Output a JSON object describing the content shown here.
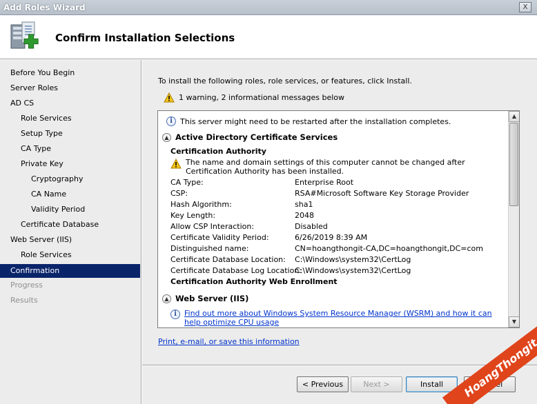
{
  "window": {
    "title": "Add Roles Wizard",
    "close_glyph": "X"
  },
  "header": {
    "page_title": "Confirm Installation Selections",
    "icon": "server-add-icon"
  },
  "sidebar": {
    "items": [
      {
        "label": "Before You Begin",
        "level": 1,
        "state": "normal"
      },
      {
        "label": "Server Roles",
        "level": 1,
        "state": "normal"
      },
      {
        "label": "AD CS",
        "level": 1,
        "state": "normal"
      },
      {
        "label": "Role Services",
        "level": 2,
        "state": "normal"
      },
      {
        "label": "Setup Type",
        "level": 2,
        "state": "normal"
      },
      {
        "label": "CA Type",
        "level": 2,
        "state": "normal"
      },
      {
        "label": "Private Key",
        "level": 2,
        "state": "normal"
      },
      {
        "label": "Cryptography",
        "level": 3,
        "state": "normal"
      },
      {
        "label": "CA Name",
        "level": 3,
        "state": "normal"
      },
      {
        "label": "Validity Period",
        "level": 3,
        "state": "normal"
      },
      {
        "label": "Certificate Database",
        "level": 2,
        "state": "normal"
      },
      {
        "label": "Web Server (IIS)",
        "level": 1,
        "state": "normal"
      },
      {
        "label": "Role Services",
        "level": 2,
        "state": "normal"
      },
      {
        "label": "Confirmation",
        "level": 1,
        "state": "active"
      },
      {
        "label": "Progress",
        "level": 1,
        "state": "disabled"
      },
      {
        "label": "Results",
        "level": 1,
        "state": "disabled"
      }
    ]
  },
  "main": {
    "intro": "To install the following roles, role services, or features, click Install.",
    "summary_warning": "1 warning, 2 informational messages below",
    "restart_note": "This server might need to be restarted after the installation completes.",
    "adcs_section": "Active Directory Certificate Services",
    "ca_heading": "Certification Authority",
    "ca_warning": "The name and domain settings of this computer cannot be changed after Certification Authority has been installed.",
    "details": [
      {
        "label": "CA Type:",
        "value": "Enterprise Root"
      },
      {
        "label": "CSP:",
        "value": "RSA#Microsoft Software Key Storage Provider"
      },
      {
        "label": "Hash Algorithm:",
        "value": "sha1"
      },
      {
        "label": "Key Length:",
        "value": "2048"
      },
      {
        "label": "Allow CSP Interaction:",
        "value": "Disabled"
      },
      {
        "label": "Certificate Validity Period:",
        "value": "6/26/2019 8:39 AM"
      },
      {
        "label": "Distinguished name:",
        "value": "CN=hoangthongit-CA,DC=hoangthongit,DC=com"
      },
      {
        "label": "Certificate Database Location:",
        "value": "C:\\Windows\\system32\\CertLog"
      },
      {
        "label": "Certificate Database Log Location:",
        "value": "C:\\Windows\\system32\\CertLog"
      }
    ],
    "web_enrollment": "Certification Authority Web Enrollment",
    "iis_section": "Web Server (IIS)",
    "wsrm_link": "Find out more about Windows System Resource Manager (WSRM) and how it can help optimize CPU usage",
    "print_link": "Print, e-mail, or save this information"
  },
  "buttons": {
    "previous": "< Previous",
    "next": "Next >",
    "install": "Install",
    "cancel": "Cancel"
  },
  "watermark": "HoangThongit.com",
  "colors": {
    "selection": "#0a246a",
    "link": "#0033cc",
    "watermark": "#e0441b"
  }
}
